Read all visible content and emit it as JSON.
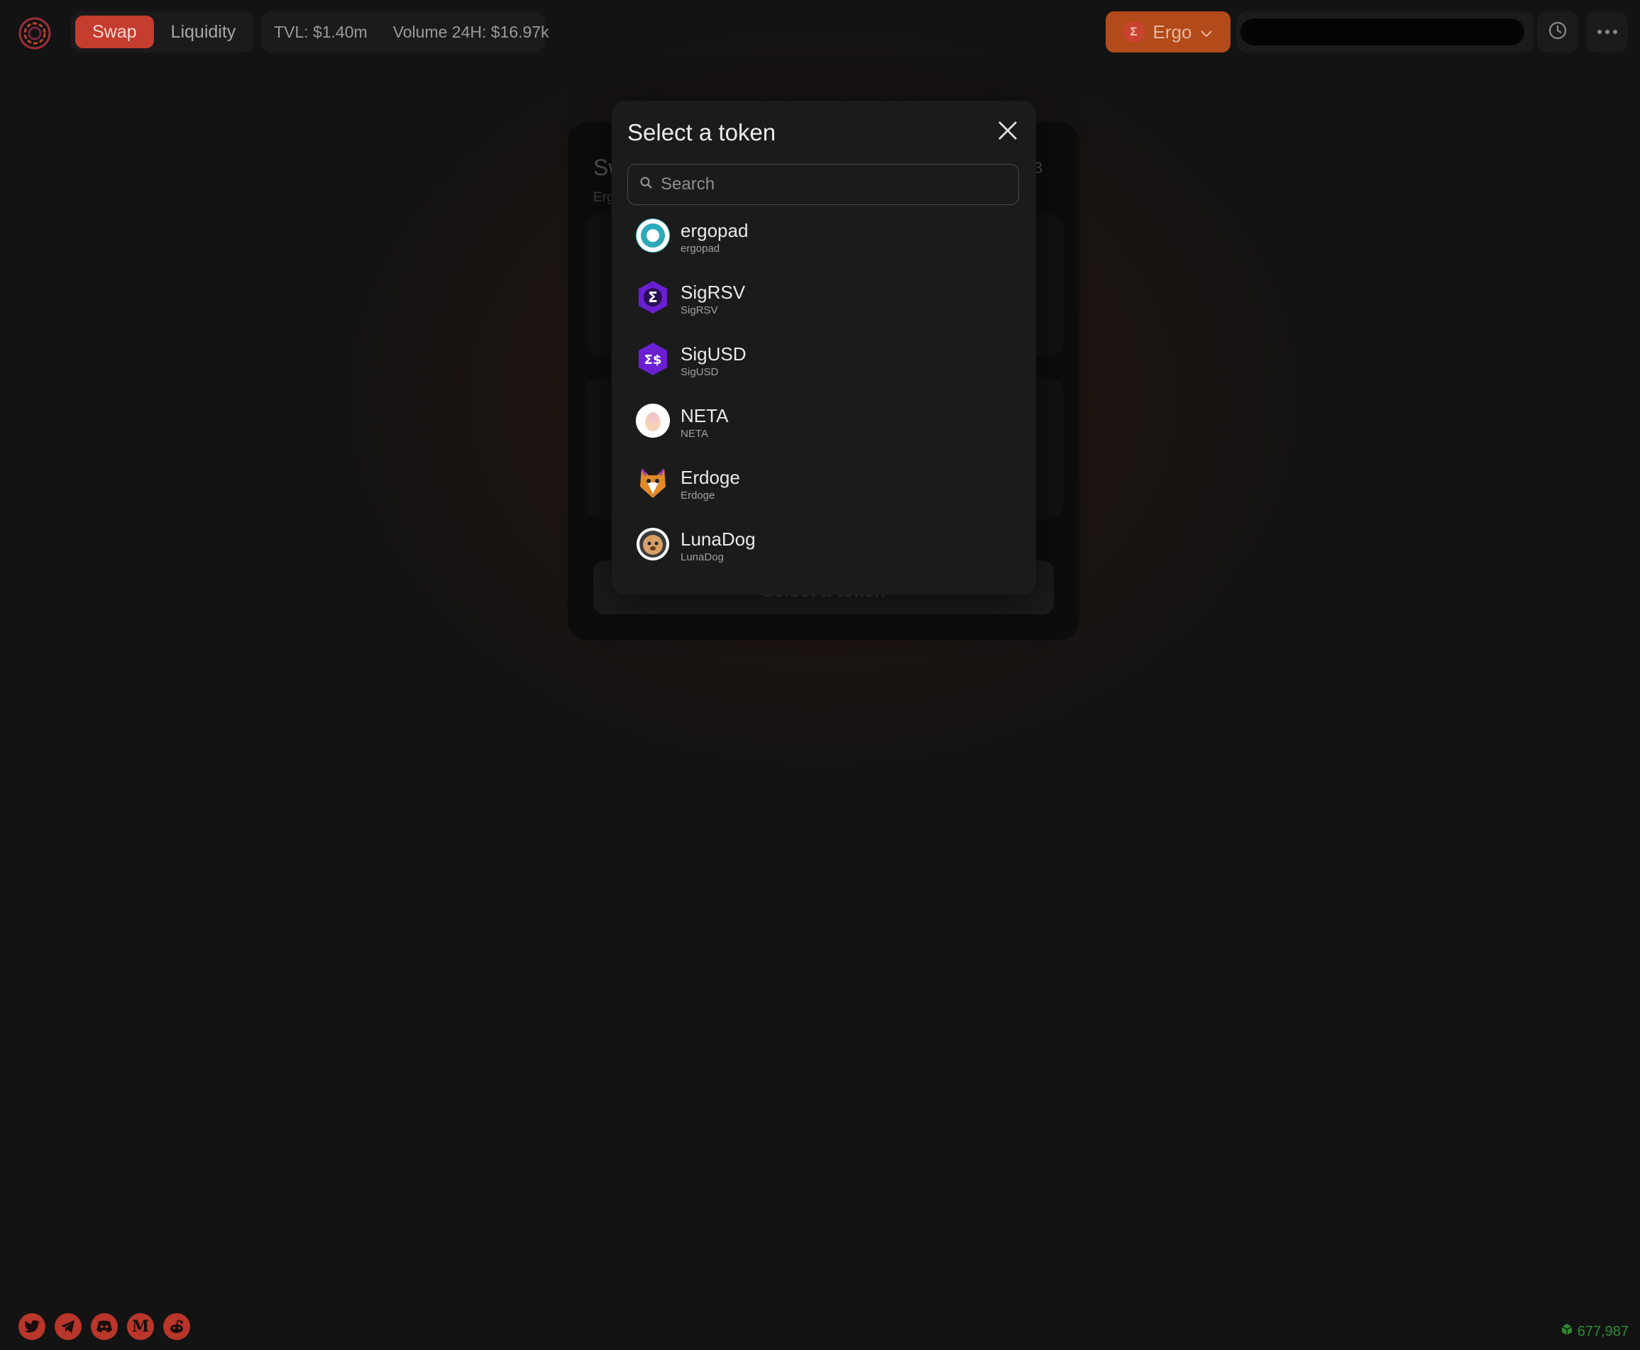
{
  "header": {
    "nav": {
      "swap_label": "Swap",
      "liquidity_label": "Liquidity"
    },
    "stats": {
      "tvl": "TVL: $1.40m",
      "volume": "Volume 24H: $16.97k"
    },
    "network": {
      "label": "Ergo",
      "coin_symbol": "Σ"
    },
    "icons": {
      "history": "history-icon",
      "more": "more-horizontal-icon"
    }
  },
  "swap_card": {
    "title_peek": "Sw",
    "subtitle_peek": "Erg",
    "number_peek": "3",
    "action_label": "Select a token"
  },
  "modal": {
    "title": "Select a token",
    "search_placeholder": "Search",
    "tokens": [
      {
        "name": "ergopad",
        "ticker": "ergopad"
      },
      {
        "name": "SigRSV",
        "ticker": "SigRSV"
      },
      {
        "name": "SigUSD",
        "ticker": "SigUSD"
      },
      {
        "name": "NETA",
        "ticker": "NETA"
      },
      {
        "name": "Erdoge",
        "ticker": "Erdoge"
      },
      {
        "name": "LunaDog",
        "ticker": "LunaDog"
      }
    ]
  },
  "footer": {
    "socials": [
      "twitter-icon",
      "telegram-icon",
      "discord-icon",
      "medium-icon",
      "reddit-icon"
    ],
    "block_height": "677,987"
  },
  "colors": {
    "accent": "#c43d2f",
    "network": "#b24a1a",
    "background": "#131313",
    "block_height": "#2e8a34"
  }
}
